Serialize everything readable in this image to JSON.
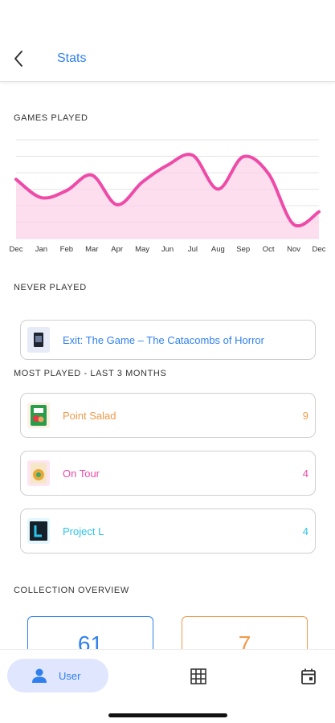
{
  "header": {
    "title": "Stats",
    "back_icon": "chevron-left-icon"
  },
  "sections": {
    "games_played": "GAMES PLAYED",
    "never_played": "NEVER PLAYED",
    "most_played": "MOST PLAYED - LAST 3 MONTHS",
    "collection_overview": "COLLECTION OVERVIEW"
  },
  "chart_data": {
    "type": "area",
    "categories": [
      "Dec",
      "Jan",
      "Feb",
      "Mar",
      "Apr",
      "May",
      "Jun",
      "Jul",
      "Aug",
      "Sep",
      "Oct",
      "Nov",
      "Dec"
    ],
    "values": [
      4.2,
      2.9,
      3.4,
      4.5,
      2.4,
      4.0,
      5.2,
      5.9,
      3.5,
      5.8,
      4.6,
      1.0,
      1.9
    ],
    "ylim": [
      0,
      7
    ],
    "grid": true,
    "line_color": "#ee4ba8",
    "fill_color": "#fbd3ea"
  },
  "never_played": [
    {
      "name": "Exit: The Game – The Catacombs of Horror",
      "color": "#2f80ed",
      "thumb_bg": "#e6ebf7",
      "icon": "game-box-icon"
    }
  ],
  "most_played": [
    {
      "name": "Point Salad",
      "count": "9",
      "color": "#f2994a",
      "thumb_bg": "#fdf1e6",
      "icon": "game-box-icon"
    },
    {
      "name": "On Tour",
      "count": "4",
      "color": "#ee4ba8",
      "thumb_bg": "#fde6f2",
      "icon": "game-box-icon"
    },
    {
      "name": "Project L",
      "count": "4",
      "color": "#2bc4e8",
      "thumb_bg": "#e3f7fd",
      "icon": "game-box-icon"
    }
  ],
  "overview": [
    {
      "value": "61",
      "color": "#2f80ed"
    },
    {
      "value": "7",
      "color": "#f2994a"
    }
  ],
  "nav": {
    "user_label": "User",
    "user_icon": "user-icon",
    "grid_icon": "grid-icon",
    "calendar_icon": "calendar-icon"
  }
}
